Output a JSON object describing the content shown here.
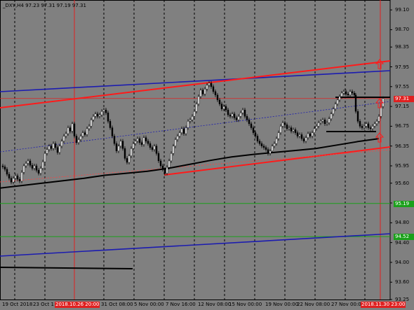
{
  "chart_data": {
    "type": "line",
    "title": "_DXY,H4  97.23 97.31 97.19 97.31",
    "y_ticks": [
      "99.10",
      "98.70",
      "98.35",
      "97.95",
      "97.55",
      "97.15",
      "96.75",
      "96.35",
      "95.95",
      "95.60",
      "95.20",
      "94.80",
      "94.40",
      "94.00",
      "93.60",
      "93.25"
    ],
    "x_ticks": [
      "19 Oct 2018",
      "23 Oct 1",
      "2018.10.26 20:00",
      "31 Oct 08:00",
      "5 Nov 00:00",
      "7 Nov 16:00",
      "12 Nov 08:00",
      "15 Nov 00:00",
      "19 Nov 00:00",
      "22 Nov 08:00",
      "27 Nov 00:00",
      "2018.11.30 23:00"
    ],
    "highlight_x_ticks": [
      "2018.10.26 20:00",
      "2018.11.30 23:00"
    ],
    "ylim": [
      93.25,
      99.3
    ],
    "current_price": "97.31",
    "level_tags": [
      {
        "label": "95.19",
        "value": 95.19,
        "color": "#1aa01a"
      },
      {
        "label": "94.52",
        "value": 94.52,
        "color": "#1aa01a"
      }
    ],
    "price_series": [
      [
        0,
        95.95
      ],
      [
        3,
        95.93
      ],
      [
        6,
        95.88
      ],
      [
        9,
        95.78
      ],
      [
        12,
        95.7
      ],
      [
        15,
        95.62
      ],
      [
        18,
        95.7
      ],
      [
        21,
        95.75
      ],
      [
        24,
        95.68
      ],
      [
        27,
        95.64
      ],
      [
        30,
        95.82
      ],
      [
        33,
        95.95
      ],
      [
        36,
        96.0
      ],
      [
        39,
        96.05
      ],
      [
        42,
        95.96
      ],
      [
        45,
        95.9
      ],
      [
        48,
        95.95
      ],
      [
        51,
        95.86
      ],
      [
        54,
        95.8
      ],
      [
        57,
        95.9
      ],
      [
        60,
        96.03
      ],
      [
        63,
        96.2
      ],
      [
        66,
        96.28
      ],
      [
        69,
        96.35
      ],
      [
        72,
        96.3
      ],
      [
        75,
        96.4
      ],
      [
        78,
        96.32
      ],
      [
        81,
        96.22
      ],
      [
        84,
        96.35
      ],
      [
        87,
        96.45
      ],
      [
        90,
        96.55
      ],
      [
        93,
        96.6
      ],
      [
        96,
        96.72
      ],
      [
        99,
        96.65
      ],
      [
        102,
        96.8
      ],
      [
        105,
        96.55
      ],
      [
        108,
        96.42
      ],
      [
        111,
        96.48
      ],
      [
        114,
        96.55
      ],
      [
        117,
        96.62
      ],
      [
        120,
        96.58
      ],
      [
        123,
        96.7
      ],
      [
        126,
        96.75
      ],
      [
        129,
        96.88
      ],
      [
        132,
        96.95
      ],
      [
        135,
        97.0
      ],
      [
        138,
        96.95
      ],
      [
        141,
        96.98
      ],
      [
        144,
        97.05
      ],
      [
        147,
        97.08
      ],
      [
        150,
        97.02
      ],
      [
        153,
        96.85
      ],
      [
        156,
        96.72
      ],
      [
        159,
        96.55
      ],
      [
        162,
        96.4
      ],
      [
        165,
        96.25
      ],
      [
        168,
        96.35
      ],
      [
        171,
        96.45
      ],
      [
        174,
        96.3
      ],
      [
        177,
        96.1
      ],
      [
        180,
        96.02
      ],
      [
        183,
        96.15
      ],
      [
        186,
        96.3
      ],
      [
        189,
        96.4
      ],
      [
        192,
        96.45
      ],
      [
        195,
        96.5
      ],
      [
        198,
        96.42
      ],
      [
        201,
        96.38
      ],
      [
        204,
        96.52
      ],
      [
        207,
        96.45
      ],
      [
        210,
        96.4
      ],
      [
        213,
        96.32
      ],
      [
        216,
        96.28
      ],
      [
        219,
        96.35
      ],
      [
        222,
        96.2
      ],
      [
        225,
        96.05
      ],
      [
        228,
        95.95
      ],
      [
        231,
        95.88
      ],
      [
        234,
        95.8
      ],
      [
        237,
        95.92
      ],
      [
        240,
        96.05
      ],
      [
        243,
        96.2
      ],
      [
        246,
        96.35
      ],
      [
        249,
        96.48
      ],
      [
        252,
        96.55
      ],
      [
        255,
        96.62
      ],
      [
        258,
        96.7
      ],
      [
        261,
        96.6
      ],
      [
        264,
        96.72
      ],
      [
        267,
        96.85
      ],
      [
        270,
        96.88
      ],
      [
        273,
        96.95
      ],
      [
        276,
        97.05
      ],
      [
        279,
        97.2
      ],
      [
        282,
        97.35
      ],
      [
        285,
        97.48
      ],
      [
        288,
        97.4
      ],
      [
        291,
        97.5
      ],
      [
        294,
        97.58
      ],
      [
        297,
        97.62
      ],
      [
        300,
        97.55
      ],
      [
        303,
        97.45
      ],
      [
        306,
        97.38
      ],
      [
        309,
        97.28
      ],
      [
        312,
        97.2
      ],
      [
        315,
        97.1
      ],
      [
        318,
        97.15
      ],
      [
        321,
        97.08
      ],
      [
        324,
        96.98
      ],
      [
        327,
        96.95
      ],
      [
        330,
        97.0
      ],
      [
        333,
        96.92
      ],
      [
        336,
        96.88
      ],
      [
        339,
        96.95
      ],
      [
        342,
        97.02
      ],
      [
        345,
        97.08
      ],
      [
        348,
        96.95
      ],
      [
        351,
        96.88
      ],
      [
        354,
        96.8
      ],
      [
        357,
        96.72
      ],
      [
        360,
        96.62
      ],
      [
        363,
        96.55
      ],
      [
        366,
        96.45
      ],
      [
        369,
        96.4
      ],
      [
        372,
        96.35
      ],
      [
        375,
        96.32
      ],
      [
        378,
        96.28
      ],
      [
        381,
        96.2
      ],
      [
        384,
        96.25
      ],
      [
        387,
        96.35
      ],
      [
        390,
        96.4
      ],
      [
        393,
        96.5
      ],
      [
        396,
        96.62
      ],
      [
        399,
        96.75
      ],
      [
        402,
        96.82
      ],
      [
        405,
        96.78
      ],
      [
        408,
        96.7
      ],
      [
        411,
        96.72
      ],
      [
        414,
        96.65
      ],
      [
        417,
        96.68
      ],
      [
        420,
        96.62
      ],
      [
        423,
        96.55
      ],
      [
        426,
        96.58
      ],
      [
        429,
        96.5
      ],
      [
        432,
        96.45
      ],
      [
        435,
        96.52
      ],
      [
        438,
        96.6
      ],
      [
        441,
        96.55
      ],
      [
        444,
        96.62
      ],
      [
        447,
        96.7
      ],
      [
        450,
        96.75
      ],
      [
        453,
        96.82
      ],
      [
        456,
        96.85
      ],
      [
        459,
        96.88
      ],
      [
        462,
        96.8
      ],
      [
        465,
        96.82
      ],
      [
        468,
        96.9
      ],
      [
        471,
        97.0
      ],
      [
        474,
        97.1
      ],
      [
        477,
        97.2
      ],
      [
        480,
        97.28
      ],
      [
        483,
        97.35
      ],
      [
        486,
        97.42
      ],
      [
        489,
        97.45
      ],
      [
        492,
        97.4
      ],
      [
        495,
        97.38
      ],
      [
        498,
        97.45
      ],
      [
        501,
        97.42
      ],
      [
        504,
        97.38
      ],
      [
        506,
        97.05
      ],
      [
        509,
        96.85
      ],
      [
        512,
        96.75
      ],
      [
        515,
        96.72
      ],
      [
        518,
        96.75
      ],
      [
        521,
        96.8
      ],
      [
        524,
        96.72
      ],
      [
        527,
        96.7
      ],
      [
        530,
        96.75
      ],
      [
        533,
        96.8
      ],
      [
        536,
        96.85
      ],
      [
        539,
        96.95
      ],
      [
        542,
        97.15
      ],
      [
        545,
        97.31
      ]
    ],
    "ma_series": [
      [
        0,
        95.5
      ],
      [
        30,
        95.55
      ],
      [
        60,
        95.6
      ],
      [
        90,
        95.65
      ],
      [
        120,
        95.7
      ],
      [
        150,
        95.76
      ],
      [
        180,
        95.8
      ],
      [
        210,
        95.84
      ],
      [
        240,
        95.9
      ],
      [
        270,
        95.98
      ],
      [
        300,
        96.06
      ],
      [
        330,
        96.13
      ],
      [
        360,
        96.18
      ],
      [
        390,
        96.22
      ],
      [
        420,
        96.26
      ],
      [
        450,
        96.3
      ],
      [
        480,
        96.37
      ],
      [
        510,
        96.44
      ],
      [
        540,
        96.5
      ]
    ]
  }
}
